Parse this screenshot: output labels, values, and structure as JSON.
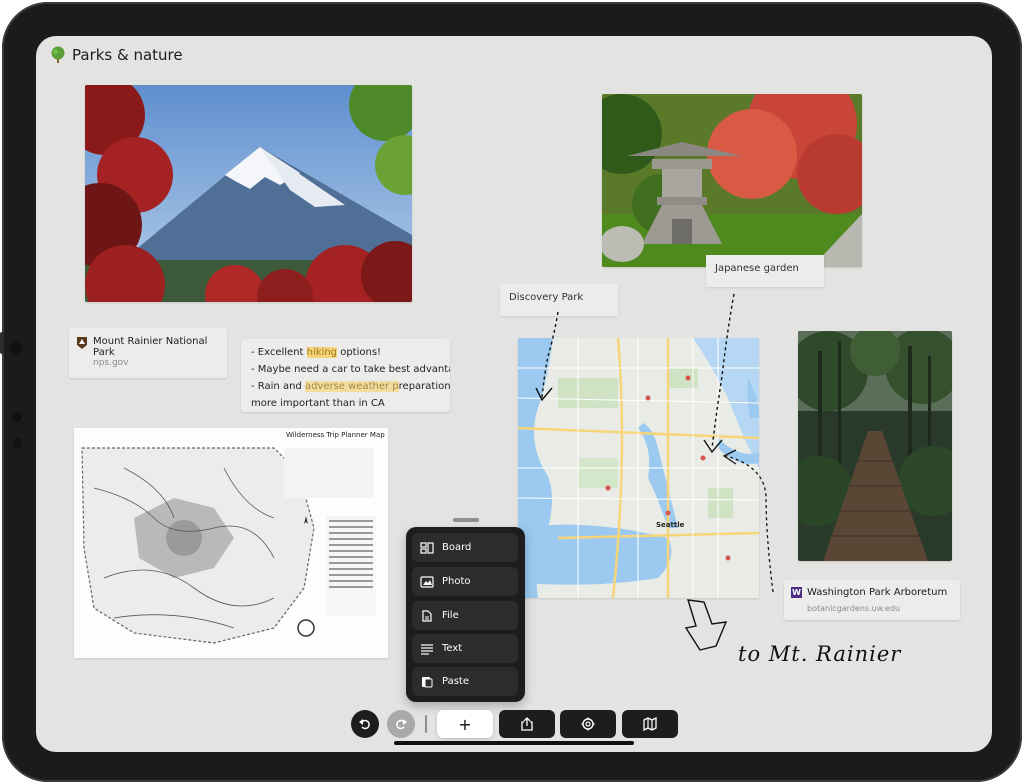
{
  "app": {
    "title": "Parks & nature"
  },
  "cards": {
    "mount_rainier": {
      "title": "Mount Rainier National Park",
      "url": "nps.gov"
    },
    "arboretum": {
      "title": "Washington Park Arboretum",
      "url": "botanicgardens.uw.edu"
    }
  },
  "note": {
    "line1_prefix": "- Excellent ",
    "line1_highlight": "hiking",
    "line1_suffix": " options!",
    "line2": "- Maybe need a car to take best advantage",
    "line3_prefix": "- Rain and ",
    "line3_highlight": "adverse weather p",
    "line3_suffix": "reparation",
    "line4": "more important than in CA"
  },
  "map_card": {
    "title": "Wilderness Trip Planner Map"
  },
  "labels": {
    "discovery_park": "Discovery Park",
    "japanese_garden": "Japanese garden",
    "map_city": "Seattle"
  },
  "handwriting": "to Mt. Rainier",
  "insert_menu": {
    "items": [
      {
        "label": "Board",
        "icon": "board-icon"
      },
      {
        "label": "Photo",
        "icon": "photo-icon"
      },
      {
        "label": "File",
        "icon": "file-icon"
      },
      {
        "label": "Text",
        "icon": "text-icon"
      },
      {
        "label": "Paste",
        "icon": "paste-icon"
      }
    ]
  },
  "toolbar": {
    "add_label": "+"
  },
  "colors": {
    "canvas": "#e3e3e1",
    "dark": "#1d1d1f",
    "highlight": "#f5d47a"
  }
}
